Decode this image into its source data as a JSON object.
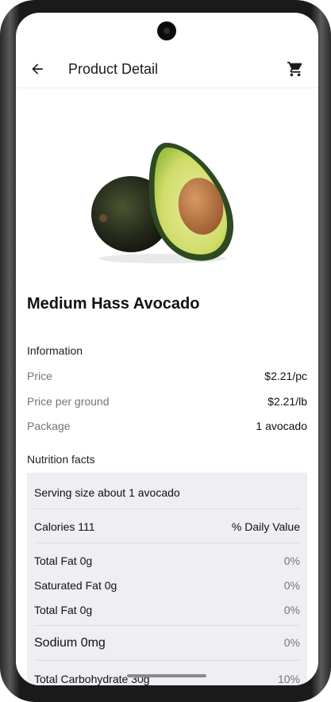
{
  "appbar": {
    "title": "Product Detail",
    "back_icon": "arrow-left-icon",
    "cart_icon": "shopping-cart-icon"
  },
  "product": {
    "name": "Medium Hass Avocado",
    "image": "avocado-image"
  },
  "information": {
    "title": "Information",
    "rows": [
      {
        "label": "Price",
        "value": "$2.21/pc"
      },
      {
        "label": "Price per ground",
        "value": "$2.21/lb"
      },
      {
        "label": "Package",
        "value": "1 avocado"
      }
    ]
  },
  "nutrition": {
    "title": "Nutrition facts",
    "serving": "Serving size about 1 avocado",
    "calories": "Calories 111",
    "daily_value_header": "% Daily Value",
    "rows": [
      {
        "label": "Total Fat 0g",
        "pct": "0%"
      },
      {
        "label": "Saturated Fat 0g",
        "pct": "0%"
      },
      {
        "label": "Total Fat 0g",
        "pct": "0%"
      },
      {
        "label": "Sodium 0mg",
        "pct": "0%"
      },
      {
        "label": "Total Carbohydrate 30g",
        "pct": "10%"
      }
    ]
  },
  "colors": {
    "background": "#ffffff",
    "nutrition_panel": "#eeeef3",
    "secondary_text": "#757575"
  }
}
